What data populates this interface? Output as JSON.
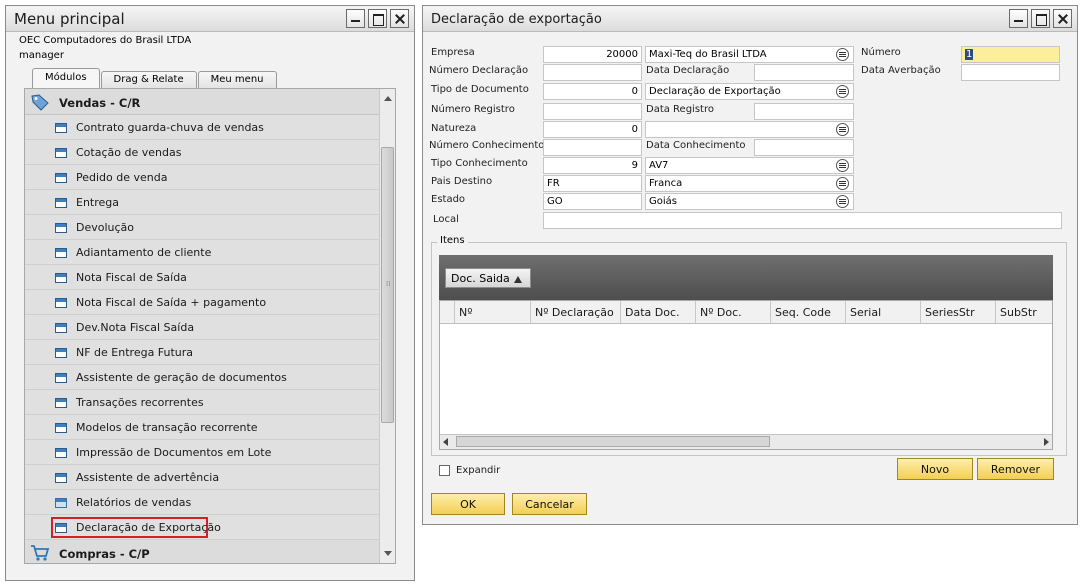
{
  "menu_window": {
    "title": "Menu principal",
    "company": "OEC Computadores do Brasil LTDA",
    "user": "manager",
    "tabs": [
      "Módulos",
      "Drag & Relate",
      "Meu menu"
    ],
    "active_tab": "Módulos",
    "section_header": "Vendas - C/R",
    "items": [
      "Contrato guarda-chuva de vendas",
      "Cotação de vendas",
      "Pedido de venda",
      "Entrega",
      "Devolução",
      "Adiantamento de cliente",
      "Nota Fiscal de Saída",
      "Nota Fiscal de Saída + pagamento",
      "Dev.Nota Fiscal Saída",
      "NF de Entrega Futura",
      "Assistente de geração de documentos",
      "Transações recorrentes",
      "Modelos de transação recorrente",
      "Impressão de Documentos em Lote",
      "Assistente de advertência",
      "Relatórios de vendas",
      "Declaração de Exportação"
    ],
    "highlighted_item": "Declaração de Exportação",
    "next_section": "Compras - C/P",
    "highlight_color": "#d2202a"
  },
  "export_window": {
    "title": "Declaração de exportação",
    "labels": {
      "empresa": "Empresa",
      "numero_declaracao": "Número Declaração",
      "data_declaracao": "Data Declaração",
      "tipo_documento": "Tipo de Documento",
      "numero_registro": "Número Registro",
      "data_registro": "Data Registro",
      "natureza": "Natureza",
      "numero_conhecimento": "Número Conhecimento",
      "data_conhecimento": "Data Conhecimento",
      "tipo_conhecimento": "Tipo Conhecimento",
      "pais_destino": "Pais Destino",
      "estado": "Estado",
      "local": "Local",
      "numero": "Número",
      "data_averbacao": "Data Averbação"
    },
    "values": {
      "empresa_code": "20000",
      "empresa_name": "Maxi-Teq do Brasil LTDA",
      "numero_declaracao": "",
      "data_declaracao": "",
      "tipo_documento_code": "0",
      "tipo_documento_name": "Declaração de Exportação",
      "numero_registro": "",
      "data_registro": "",
      "natureza_code": "0",
      "natureza_name": "",
      "numero_conhecimento": "",
      "data_conhecimento": "",
      "tipo_conhecimento_code": "9",
      "tipo_conhecimento_name": "AV7",
      "pais_destino_code": "FR",
      "pais_destino_name": "Franca",
      "estado_code": "GO",
      "estado_name": "Goiás",
      "local": "",
      "numero": "1",
      "data_averbacao": ""
    },
    "itens": {
      "title": "Itens",
      "group_by": "Doc. Saida",
      "columns": [
        "Nº",
        "Nº Declaração",
        "Data Doc.",
        "Nº Doc.",
        "Seq. Code",
        "Serial",
        "SeriesStr",
        "SubStr"
      ],
      "rows": []
    },
    "expandir_label": "Expandir",
    "buttons": {
      "novo": "Novo",
      "remover": "Remover",
      "ok": "OK",
      "cancelar": "Cancelar"
    },
    "accent_color": "#f3cf52",
    "highlight_field_color": "#fbee9d"
  }
}
